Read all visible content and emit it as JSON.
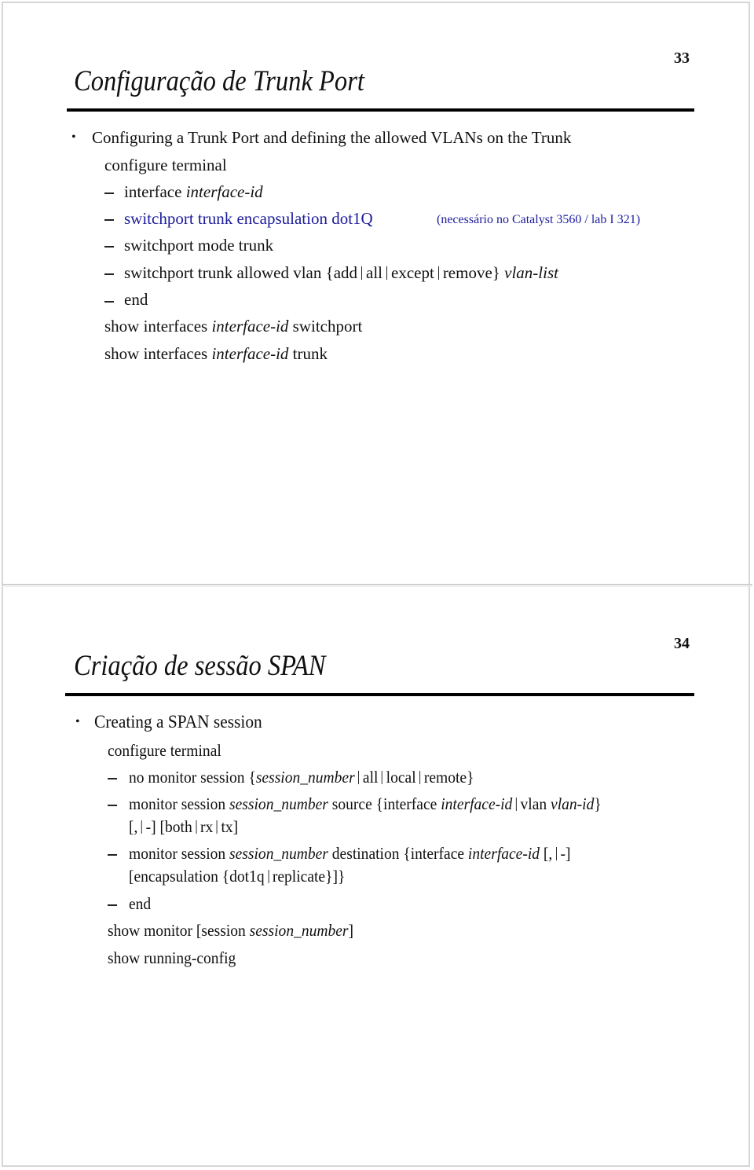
{
  "slides": [
    {
      "page_number": "33",
      "title": "Configuração de Trunk Port",
      "bullet": "Configuring a Trunk Port and defining the allowed VLANs on the Trunk",
      "commands": {
        "configure": "configure terminal",
        "interface": {
          "cmd": "interface ",
          "arg": "interface-id"
        },
        "encapsulation": {
          "cmd": "switchport trunk encapsulation dot1Q",
          "note": "(necessário no Catalyst 3560 / lab I 321)"
        },
        "mode": "switchport mode trunk",
        "allowed": {
          "prefix": "switchport trunk allowed vlan {add",
          "opt1": "all",
          "opt2": "except",
          "opt3": "remove}",
          "arg": "vlan-list"
        },
        "end": "end",
        "show_switchport": {
          "prefix": "show interfaces ",
          "arg": "interface-id",
          "suffix": " switchport"
        },
        "show_trunk": {
          "prefix": "show interfaces ",
          "arg": "interface-id",
          "suffix": " trunk"
        }
      }
    },
    {
      "page_number": "34",
      "title": "Criação de sessão SPAN",
      "bullet": "Creating a SPAN session",
      "commands": {
        "configure": "configure terminal",
        "no_monitor": {
          "prefix": "no monitor session {",
          "arg": "session_number",
          "opt1": "all",
          "opt2": "local",
          "opt3": "remote}"
        },
        "source": {
          "prefix": "monitor session ",
          "arg": "session_number",
          "mid": " source {interface ",
          "arg2": "interface-id",
          "opt": "vlan ",
          "arg3": "vlan-id",
          "end": "}",
          "line2_a": "[,",
          "line2_b": "-] [both",
          "line2_c": "rx",
          "line2_d": "tx]"
        },
        "destination": {
          "prefix": "monitor session ",
          "arg": "session_number",
          "mid": " destination {interface ",
          "arg2": "interface-id",
          "tail_a": " [,",
          "tail_b": "-]",
          "line2_a": "[encapsulation {dot1q",
          "line2_b": "replicate}]}"
        },
        "end": "end",
        "show_monitor": {
          "prefix": "show monitor [session ",
          "arg": "session_number",
          "suffix": "]"
        },
        "show_running": "show running-config"
      }
    }
  ]
}
